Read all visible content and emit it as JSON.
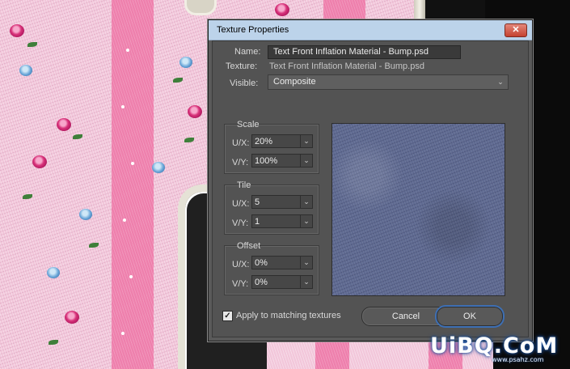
{
  "dialog": {
    "title": "Texture Properties",
    "close_glyph": "✕",
    "name_label": "Name:",
    "name_value": "Text Front Inflation Material - Bump.psd",
    "texture_label": "Texture:",
    "texture_value": "Text Front Inflation Material - Bump.psd",
    "visible_label": "Visible:",
    "visible_value": "Composite",
    "scale": {
      "title": "Scale",
      "ux_label": "U/X:",
      "ux_value": "20%",
      "vy_label": "V/Y:",
      "vy_value": "100%"
    },
    "tile": {
      "title": "Tile",
      "ux_label": "U/X:",
      "ux_value": "5",
      "vy_label": "V/Y:",
      "vy_value": "1"
    },
    "offset": {
      "title": "Offset",
      "ux_label": "U/X:",
      "ux_value": "0%",
      "vy_label": "V/Y:",
      "vy_value": "0%"
    },
    "apply_label": "Apply to matching textures",
    "apply_checked_glyph": "✓",
    "cancel_label": "Cancel",
    "ok_label": "OK",
    "chevron_glyph": "⌄"
  },
  "watermark": {
    "main": "UiBQ.CoM",
    "sub": "www.psahz.com"
  },
  "colors": {
    "dialog_bg": "#535353",
    "titlebar": "#bcd3ea",
    "close_red": "#c54230",
    "ok_focus": "#3e6fb3",
    "fabric_pink": "#f2c6da",
    "stripe_pink": "#ee7fac",
    "preview_denim": "#5f6a91"
  }
}
